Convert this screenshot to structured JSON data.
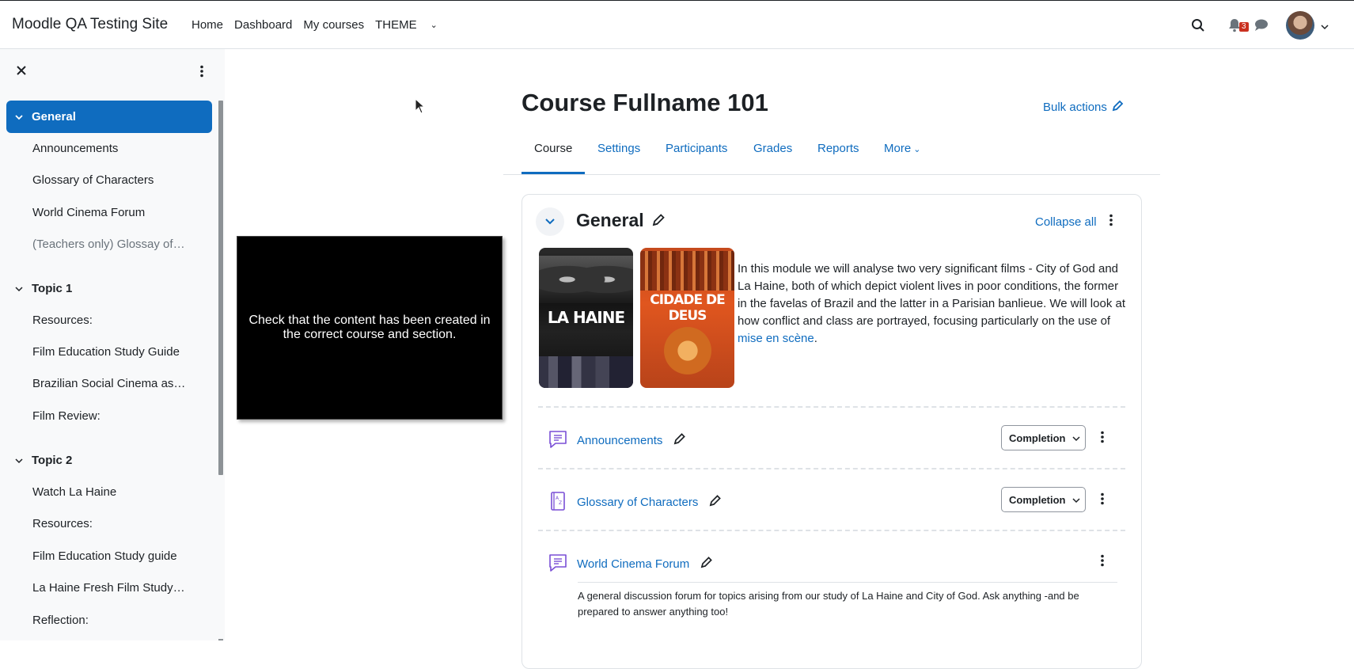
{
  "navbar": {
    "brand": "Moodle QA Testing Site",
    "links": [
      "Home",
      "Dashboard",
      "My courses",
      "THEME"
    ],
    "notification_count": "3"
  },
  "drawer": {
    "sections": [
      {
        "title": "General",
        "active": true,
        "items": [
          "Announcements",
          "Glossary of Characters",
          "World Cinema Forum",
          "(Teachers only) Glossay of…"
        ]
      },
      {
        "title": "Topic 1",
        "items": [
          "Resources:",
          "Film Education Study Guide",
          "Brazilian Social Cinema as…",
          "Film Review:"
        ]
      },
      {
        "title": "Topic 2",
        "items": [
          "Watch La Haine",
          "Resources:",
          "Film Education Study guide",
          "La Haine Fresh Film Study…",
          "Reflection:"
        ]
      }
    ]
  },
  "overlay": {
    "text": "Check that the content has been created in the correct course and section."
  },
  "course": {
    "title": "Course Fullname 101",
    "bulk_actions": "Bulk actions",
    "tabs": [
      "Course",
      "Settings",
      "Participants",
      "Grades",
      "Reports",
      "More"
    ],
    "active_tab": "Course"
  },
  "section": {
    "title": "General",
    "collapse_all": "Collapse all",
    "posters": [
      "LA HAINE",
      "CIDADE DE DEUS"
    ],
    "summary_text": "In this module we will analyse two very significant films - City of God and La Haine, both of which depict violent lives in poor conditions, the former in the favelas of Brazil and the latter in a Parisian banlieue. We will look at how conflict and class are portrayed, focusing particularly on the use of ",
    "summary_link": "mise en scène",
    "summary_end": ".",
    "activities": [
      {
        "name": "Announcements",
        "completion": "Completion"
      },
      {
        "name": "Glossary of Characters",
        "completion": "Completion"
      },
      {
        "name": "World Cinema Forum",
        "description": "A general discussion forum for topics arising from our study of La Haine and City of God. Ask anything -and be prepared to answer anything too!"
      }
    ]
  },
  "colors": {
    "brand_blue": "#0f6cbf",
    "activity_purple": "#7a4fd6",
    "badge_red": "#ca3120"
  }
}
